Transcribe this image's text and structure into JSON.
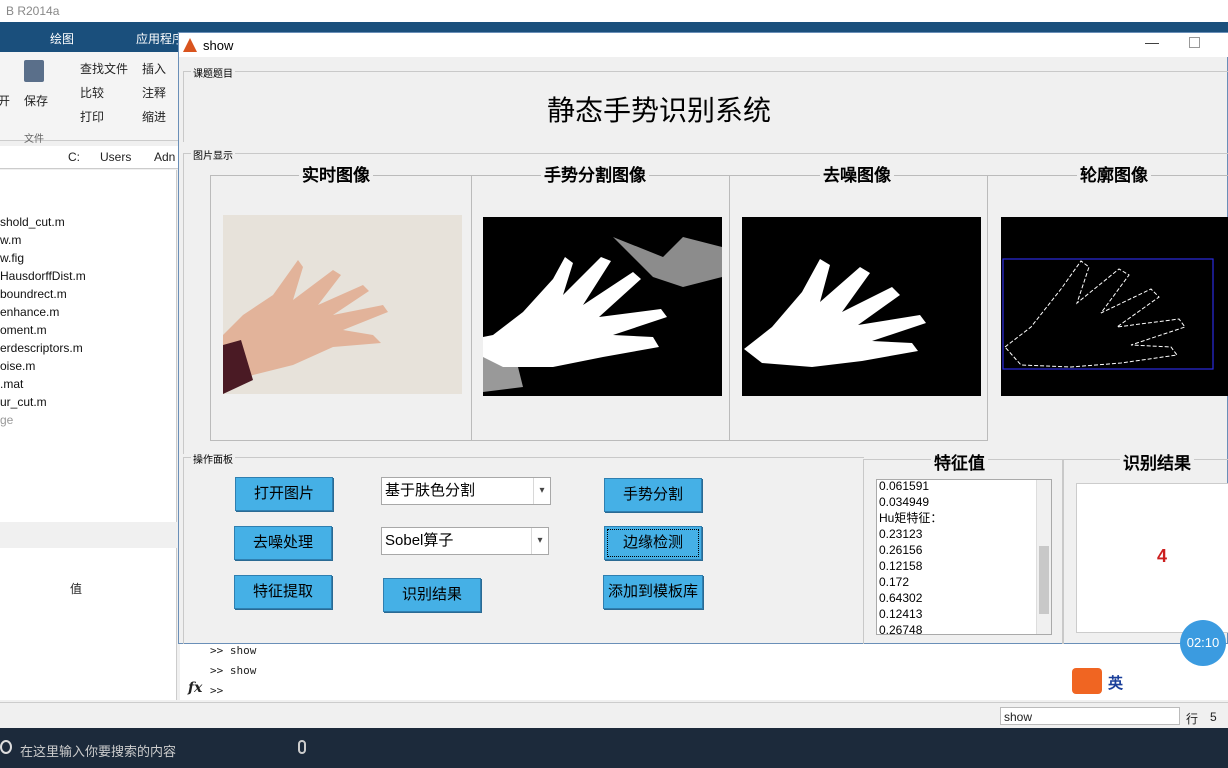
{
  "matlab": {
    "title": "B R2014a",
    "tabs": [
      "绘图",
      "应用程序"
    ],
    "ribbon": {
      "save": "保存",
      "open_suffix": "开",
      "find_files": "查找文件",
      "compare": "比较",
      "print": "打印",
      "insert": "插入",
      "comment": "注释",
      "indent": "缩进",
      "file_group": "文件"
    },
    "path": [
      "C:",
      "Users",
      "Adn"
    ],
    "files": [
      "shold_cut.m",
      "w.m",
      "w.fig",
      "HausdorffDist.m",
      "boundrect.m",
      "enhance.m",
      "oment.m",
      "erdescriptors.m",
      "oise.m",
      ".mat",
      "ur_cut.m",
      "ge"
    ],
    "workspace_col": "值",
    "command_history": [
      ">> show",
      ">> show"
    ],
    "prompt": ">>",
    "fx": "fx",
    "status_right": "show",
    "status_row": "行",
    "status_row_num": "5"
  },
  "figure": {
    "window_title": "show",
    "groups": {
      "title_group": "课题题目",
      "images_group": "图片显示",
      "ops_group": "操作面板"
    },
    "app_title": "静态手势识别系统",
    "image_headers": [
      "实时图像",
      "手势分割图像",
      "去噪图像",
      "轮廓图像"
    ],
    "buttons": {
      "open": "打开图片",
      "denoise": "去噪处理",
      "features": "特征提取",
      "segment": "手势分割",
      "edge": "边缘检测",
      "add_template": "添加到模板库",
      "recognize": "识别结果"
    },
    "selects": {
      "segmentation_method": "基于肤色分割",
      "edge_operator": "Sobel算子"
    },
    "features_header": "特征值",
    "features_list": [
      "0.061591",
      "0.034949",
      "Hu矩特征：",
      "0.23123",
      "0.26156",
      "0.12158",
      "0.172",
      "0.64302",
      "0.12413",
      "0.26748"
    ],
    "result_header": "识别结果",
    "result_value": "4",
    "result_color": "#cc1f1f"
  },
  "overlay": {
    "timer": "02:10",
    "ime_label": "英"
  },
  "taskbar": {
    "search_placeholder": "在这里输入你要搜索的内容"
  }
}
